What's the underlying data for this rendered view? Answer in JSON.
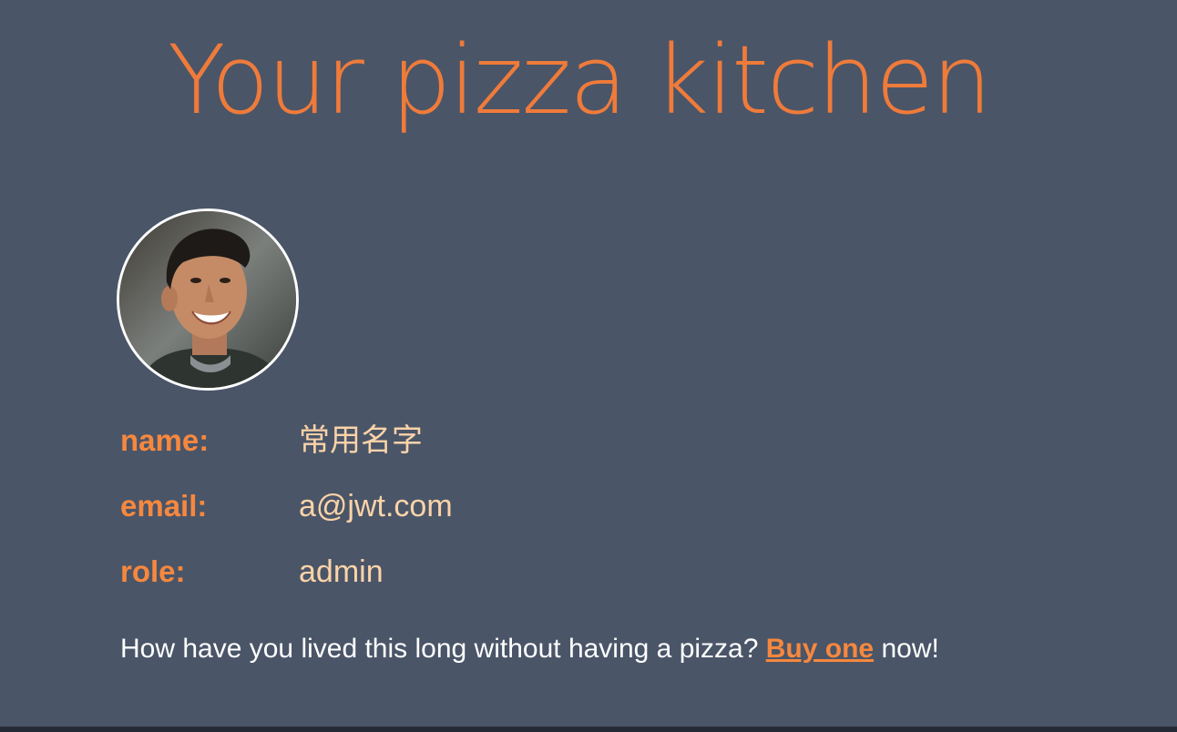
{
  "header": {
    "title": "Your pizza kitchen"
  },
  "profile": {
    "avatar_icon": "user-portrait",
    "fields": [
      {
        "label": "name:",
        "value": "常用名字"
      },
      {
        "label": "email:",
        "value": "a@jwt.com"
      },
      {
        "label": "role:",
        "value": "admin"
      }
    ]
  },
  "message": {
    "prefix": "How have you lived this long without having a pizza? ",
    "link_label": "Buy one",
    "suffix": " now!"
  },
  "colors": {
    "background": "#4a5568",
    "accent": "#f6883e",
    "title": "#ef7b3a",
    "value_text": "#fbd3a8"
  }
}
